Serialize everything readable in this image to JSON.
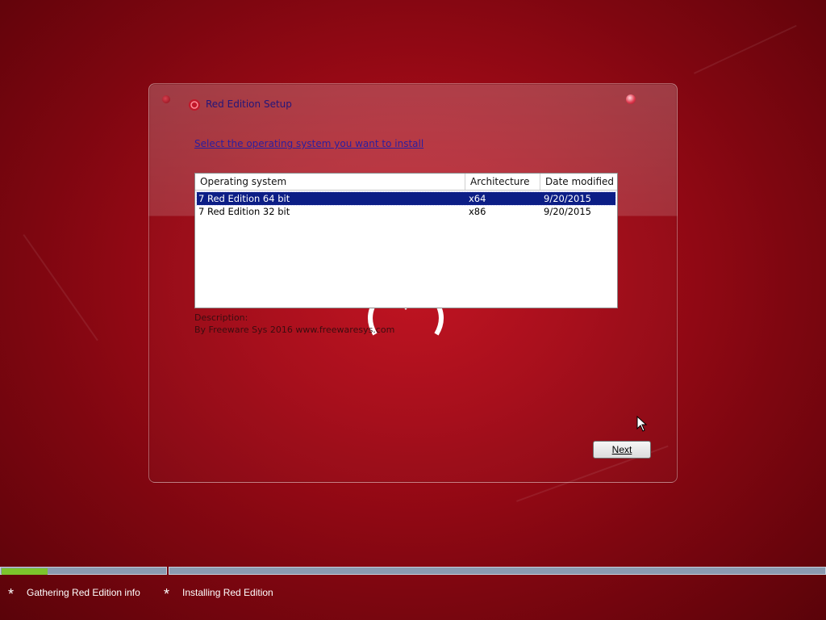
{
  "window": {
    "title": "Red Edition Setup",
    "prompt": "Select the operating system you want to install",
    "close_icon": "close-icon"
  },
  "listview": {
    "columns": [
      "Operating system",
      "Architecture",
      "Date modified"
    ],
    "rows": [
      {
        "os": "7 Red Edition 64 bit",
        "arch": "x64",
        "date": "9/20/2015",
        "selected": true
      },
      {
        "os": "7 Red Edition 32 bit",
        "arch": "x86",
        "date": "9/20/2015",
        "selected": false
      }
    ]
  },
  "description": {
    "label": "Description:",
    "text": "By Freeware Sys 2016 www.freewaresys.com"
  },
  "buttons": {
    "next": "Next"
  },
  "progress": {
    "stage1_fill": 0.28,
    "steps": [
      "Gathering Red Edition info",
      "Installing Red Edition"
    ]
  },
  "colors": {
    "background": "#a50b18",
    "selection": "#0c1e86",
    "progress_fill": "#7cc52c",
    "progress_track": "#8b9ab0"
  }
}
